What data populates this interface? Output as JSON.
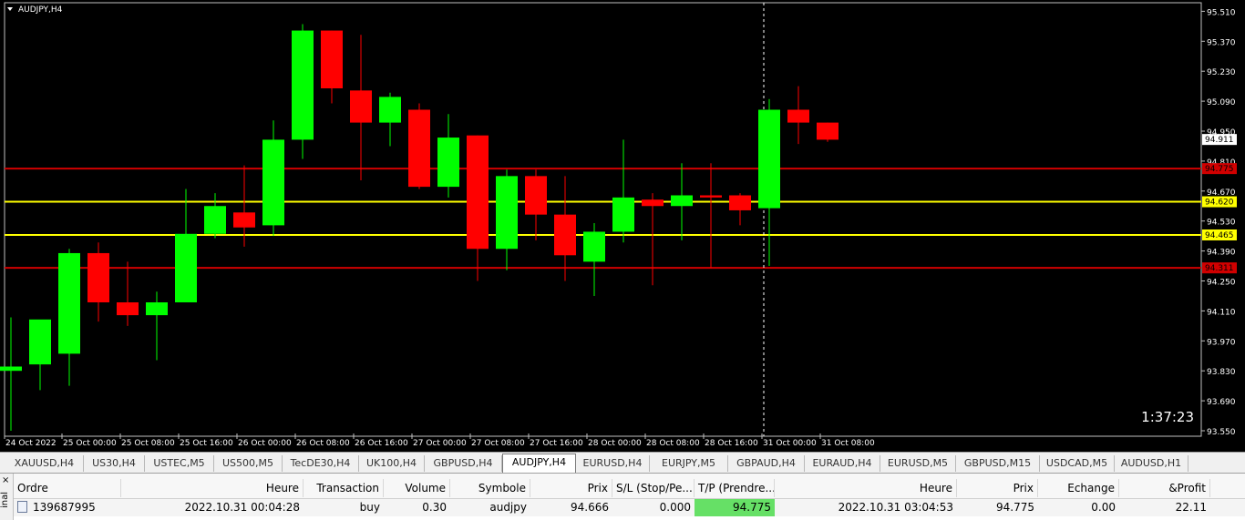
{
  "chart": {
    "symbol_label": "AUDJPY,H4",
    "countdown": "1:37:23",
    "colors": {
      "background": "#000000",
      "bull": "#00ff00",
      "bear": "#ff0000",
      "red_line": "#d00000",
      "yellow_line": "#ffff00",
      "axis_text": "#ffffff"
    },
    "price_range": [
      93.55,
      95.55
    ],
    "price_ticks": [
      "95.510",
      "95.370",
      "95.230",
      "95.090",
      "94.950",
      "94.810",
      "94.670",
      "94.530",
      "94.390",
      "94.250",
      "94.110",
      "93.970",
      "93.830",
      "93.690",
      "93.550"
    ],
    "time_labels": [
      "24 Oct 2022",
      "25 Oct 00:00",
      "25 Oct 08:00",
      "25 Oct 16:00",
      "26 Oct 00:00",
      "26 Oct 08:00",
      "26 Oct 16:00",
      "27 Oct 00:00",
      "27 Oct 08:00",
      "27 Oct 16:00",
      "28 Oct 00:00",
      "28 Oct 08:00",
      "28 Oct 16:00",
      "31 Oct 00:00",
      "31 Oct 08:00"
    ],
    "horizontal_lines": [
      {
        "price": 94.775,
        "label": "94.775",
        "color": "#d00000"
      },
      {
        "price": 94.62,
        "label": "94.620",
        "color": "#ffff00"
      },
      {
        "price": 94.465,
        "label": "94.465",
        "color": "#ffff00"
      },
      {
        "price": 94.311,
        "label": "94.311",
        "color": "#d00000"
      }
    ],
    "current_price": {
      "value": 94.911,
      "label": "94.911"
    },
    "candles": [
      {
        "o": 93.83,
        "h": 94.08,
        "l": 93.55,
        "c": 93.85
      },
      {
        "o": 93.86,
        "h": 94.03,
        "l": 93.74,
        "c": 94.07
      },
      {
        "o": 93.91,
        "h": 94.4,
        "l": 93.76,
        "c": 94.38
      },
      {
        "o": 94.38,
        "h": 94.43,
        "l": 94.06,
        "c": 94.15
      },
      {
        "o": 94.15,
        "h": 94.34,
        "l": 94.04,
        "c": 94.09
      },
      {
        "o": 94.09,
        "h": 94.2,
        "l": 93.88,
        "c": 94.15
      },
      {
        "o": 94.15,
        "h": 94.68,
        "l": 94.15,
        "c": 94.47
      },
      {
        "o": 94.47,
        "h": 94.66,
        "l": 94.45,
        "c": 94.6
      },
      {
        "o": 94.57,
        "h": 94.79,
        "l": 94.41,
        "c": 94.5
      },
      {
        "o": 94.51,
        "h": 95.0,
        "l": 94.46,
        "c": 94.91
      },
      {
        "o": 94.91,
        "h": 95.45,
        "l": 94.82,
        "c": 95.42
      },
      {
        "o": 95.42,
        "h": 95.42,
        "l": 95.08,
        "c": 95.15
      },
      {
        "o": 95.14,
        "h": 95.4,
        "l": 94.72,
        "c": 94.99
      },
      {
        "o": 94.99,
        "h": 95.13,
        "l": 94.88,
        "c": 95.11
      },
      {
        "o": 95.05,
        "h": 95.08,
        "l": 94.68,
        "c": 94.69
      },
      {
        "o": 94.69,
        "h": 95.03,
        "l": 94.64,
        "c": 94.92
      },
      {
        "o": 94.93,
        "h": 94.93,
        "l": 94.25,
        "c": 94.4
      },
      {
        "o": 94.4,
        "h": 94.77,
        "l": 94.3,
        "c": 94.74
      },
      {
        "o": 94.74,
        "h": 94.77,
        "l": 94.44,
        "c": 94.56
      },
      {
        "o": 94.56,
        "h": 94.74,
        "l": 94.25,
        "c": 94.37
      },
      {
        "o": 94.34,
        "h": 94.52,
        "l": 94.18,
        "c": 94.48
      },
      {
        "o": 94.48,
        "h": 94.91,
        "l": 94.43,
        "c": 94.64
      },
      {
        "o": 94.63,
        "h": 94.66,
        "l": 94.23,
        "c": 94.6
      },
      {
        "o": 94.6,
        "h": 94.8,
        "l": 94.44,
        "c": 94.65
      },
      {
        "o": 94.65,
        "h": 94.8,
        "l": 94.31,
        "c": 94.64
      },
      {
        "o": 94.65,
        "h": 94.66,
        "l": 94.51,
        "c": 94.58
      },
      {
        "o": 94.59,
        "h": 95.1,
        "l": 94.32,
        "c": 95.05
      },
      {
        "o": 95.05,
        "h": 95.16,
        "l": 94.89,
        "c": 94.99
      },
      {
        "o": 94.99,
        "h": 94.99,
        "l": 94.9,
        "c": 94.91
      }
    ]
  },
  "tabs": [
    {
      "label": "XAUUSD,H4",
      "active": false
    },
    {
      "label": "US30,H4",
      "active": false
    },
    {
      "label": "USTEC,M5",
      "active": false
    },
    {
      "label": "US500,M5",
      "active": false
    },
    {
      "label": "TecDE30,H4",
      "active": false
    },
    {
      "label": "UK100,H4",
      "active": false
    },
    {
      "label": "GBPUSD,H4",
      "active": false
    },
    {
      "label": "AUDJPY,H4",
      "active": true
    },
    {
      "label": "EURUSD,H4",
      "active": false
    },
    {
      "label": "EURJPY,M5",
      "active": false
    },
    {
      "label": "GBPAUD,H4",
      "active": false
    },
    {
      "label": "EURAUD,H4",
      "active": false
    },
    {
      "label": "EURUSD,M5",
      "active": false
    },
    {
      "label": "GBPUSD,M15",
      "active": false
    },
    {
      "label": "USDCAD,M5",
      "active": false
    },
    {
      "label": "AUDUSD,H1",
      "active": false
    }
  ],
  "terminal": {
    "side_label": "inal",
    "close_symbol": "×",
    "headers": [
      "Ordre",
      "Heure",
      "Transaction",
      "Volume",
      "Symbole",
      "Prix",
      "S/L (Stop/Pe...",
      "T/P (Prendre...",
      "Heure",
      "Prix",
      "Echange",
      "&Profit"
    ],
    "row": {
      "order": "139687995",
      "time": "2022.10.31 00:04:28",
      "transaction": "buy",
      "volume": "0.30",
      "symbol": "audjpy",
      "price": "94.666",
      "sl": "0.000",
      "tp": "94.775",
      "time2": "2022.10.31 03:04:53",
      "price2": "94.775",
      "swap": "0.00",
      "profit": "22.11"
    }
  }
}
